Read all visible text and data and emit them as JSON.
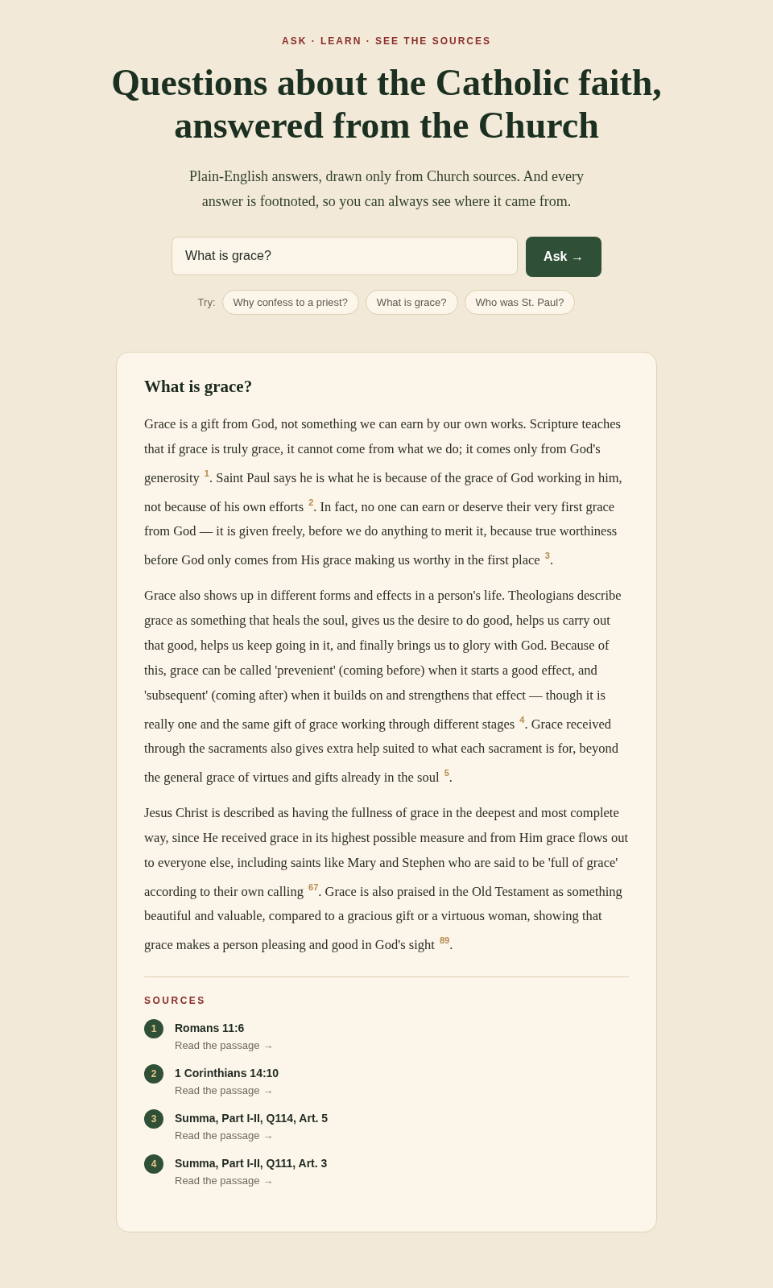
{
  "eyebrow": "ASK · LEARN · SEE THE SOURCES",
  "title": "Questions about the Catholic faith, answered from the Church",
  "subtitle": "Plain-English answers, drawn only from Church sources. And every answer is footnoted, so you can always see where it came from.",
  "search": {
    "value": "What is grace?",
    "button": "Ask →"
  },
  "suggestions": {
    "label": "Try:",
    "items": [
      "Why confess to a priest?",
      "What is grace?",
      "Who was St. Paul?"
    ]
  },
  "answer": {
    "question": "What is grace?",
    "paragraphs": [
      "Grace is a gift from God, not something we can earn by our own works. Scripture teaches that if grace is truly grace, it cannot come from what we do; it comes only from God's generosity $^{1}$. Saint Paul says he is what he is because of the grace of God working in him, not because of his own efforts $^{2}$. In fact, no one can earn or deserve their very first grace from God — it is given freely, before we do anything to merit it, because true worthiness before God only comes from His grace making us worthy in the first place $^{3}$.",
      "Grace also shows up in different forms and effects in a person's life. Theologians describe grace as something that heals the soul, gives us the desire to do good, helps us carry out that good, helps us keep going in it, and finally brings us to glory with God. Because of this, grace can be called 'prevenient' (coming before) when it starts a good effect, and 'subsequent' (coming after) when it builds on and strengthens that effect — though it is really one and the same gift of grace working through different stages $^{4}$. Grace received through the sacraments also gives extra help suited to what each sacrament is for, beyond the general grace of virtues and gifts already in the soul $^{5}$.",
      "Jesus Christ is described as having the fullness of grace in the deepest and most complete way, since He received grace in its highest possible measure and from Him grace flows out to everyone else, including saints like Mary and Stephen who are said to be 'full of grace' according to their own calling $^{67}$. Grace is also praised in the Old Testament as something beautiful and valuable, compared to a gracious gift or a virtuous woman, showing that grace makes a person pleasing and good in God's sight $^{89}$."
    ],
    "sources_label": "SOURCES",
    "sources": [
      {
        "number": "1",
        "title": "Romans 11:6",
        "link": "Read the passage →"
      },
      {
        "number": "2",
        "title": "1 Corinthians 14:10",
        "link": "Read the passage →"
      },
      {
        "number": "3",
        "title": "Summa, Part I-II, Q114, Art. 5",
        "link": "Read the passage →"
      },
      {
        "number": "4",
        "title": "Summa, Part I-II, Q111, Art. 3",
        "link": "Read the passage →"
      }
    ]
  }
}
